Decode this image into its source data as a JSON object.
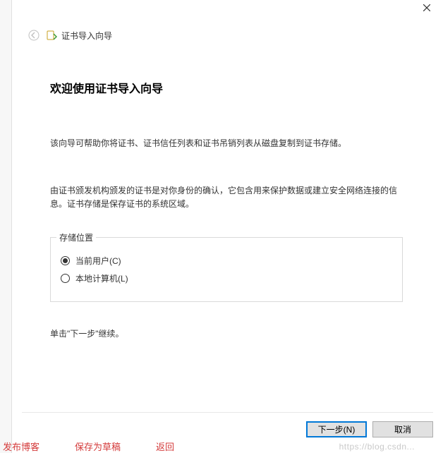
{
  "header": {
    "wizard_name": "证书导入向导"
  },
  "main": {
    "heading": "欢迎使用证书导入向导",
    "paragraph1": "该向导可帮助你将证书、证书信任列表和证书吊销列表从磁盘复制到证书存储。",
    "paragraph2": "由证书颁发机构颁发的证书是对你身份的确认，它包含用来保护数据或建立安全网络连接的信息。证书存储是保存证书的系统区域。",
    "storage": {
      "legend": "存储位置",
      "option_current_user": "当前用户(C)",
      "option_local_machine": "本地计算机(L)",
      "selected": "current_user"
    },
    "continue_hint": "单击\"下一步\"继续。"
  },
  "buttons": {
    "next": "下一步(N)",
    "cancel": "取消"
  },
  "watermark": "https://blog.csdn...",
  "background_fragments": {
    "bottom_left_1": "发布博客",
    "bottom_left_2": "保存为草稿",
    "bottom_left_3": "返回"
  }
}
